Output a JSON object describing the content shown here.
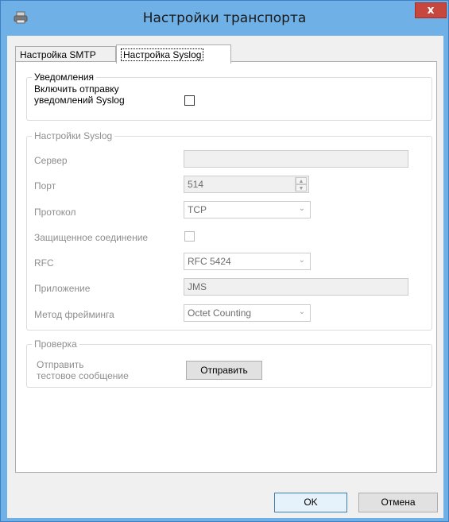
{
  "window": {
    "title": "Настройки транспорта",
    "close_glyph": "x"
  },
  "tabs": [
    {
      "label": "Настройка SMTP",
      "selected": false
    },
    {
      "label": "Настройка Syslog",
      "selected": true
    }
  ],
  "notifications": {
    "legend": "Уведомления",
    "enable_label_line1": "Включить отправку",
    "enable_label_line2": "уведомлений Syslog",
    "enable_checked": false
  },
  "syslog": {
    "legend": "Настройки Syslog",
    "server_label": "Сервер",
    "server_value": "",
    "port_label": "Порт",
    "port_value": "514",
    "protocol_label": "Протокол",
    "protocol_value": "TCP",
    "secure_label": "Защищенное соединение",
    "secure_checked": false,
    "rfc_label": "RFC",
    "rfc_value": "RFC 5424",
    "app_label": "Приложение",
    "app_value": "JMS",
    "framing_label": "Метод фрейминга",
    "framing_value": "Octet Counting"
  },
  "check": {
    "legend": "Проверка",
    "send_test_line1": "Отправить",
    "send_test_line2": "тестовое сообщение",
    "send_button": "Отправить"
  },
  "footer": {
    "ok_label": "OK",
    "cancel_label": "Отмена"
  },
  "icons": {
    "app": "printer-icon",
    "dropdown": "chevron-down-icon",
    "spin_up": "spin-up-icon",
    "spin_down": "spin-down-icon"
  }
}
